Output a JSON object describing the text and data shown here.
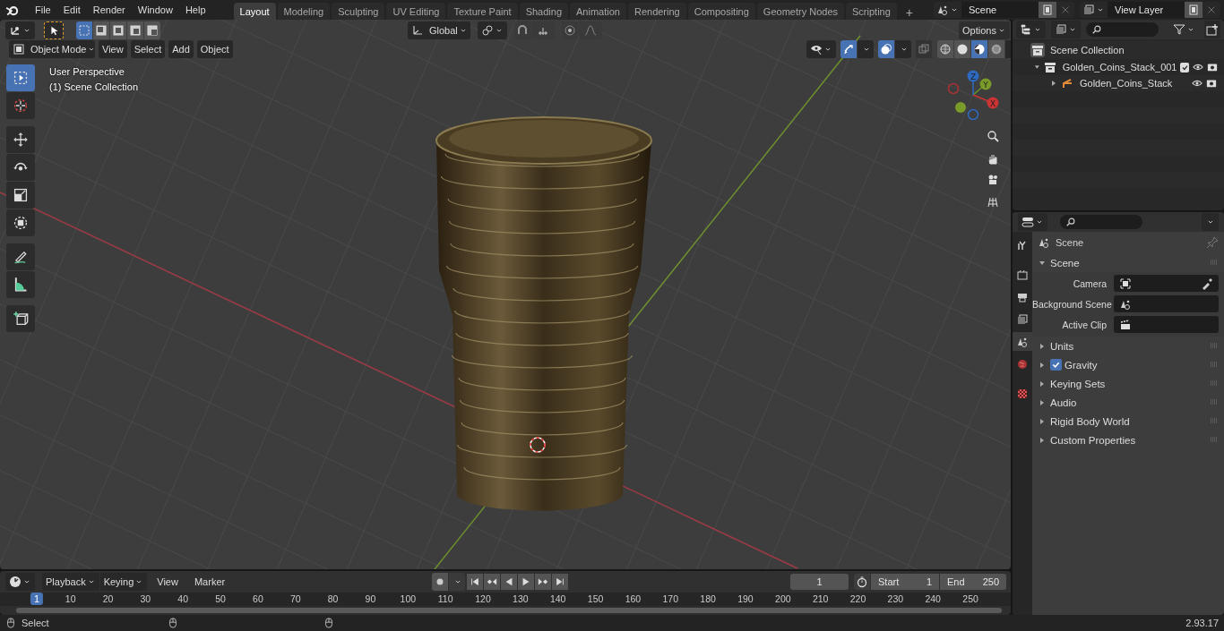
{
  "topbar": {
    "menus": [
      "File",
      "Edit",
      "Render",
      "Window",
      "Help"
    ],
    "workspaces": [
      {
        "label": "Layout",
        "selected": true
      },
      {
        "label": "Modeling",
        "selected": false
      },
      {
        "label": "Sculpting",
        "selected": false
      },
      {
        "label": "UV Editing",
        "selected": false
      },
      {
        "label": "Texture Paint",
        "selected": false
      },
      {
        "label": "Shading",
        "selected": false
      },
      {
        "label": "Animation",
        "selected": false
      },
      {
        "label": "Rendering",
        "selected": false
      },
      {
        "label": "Compositing",
        "selected": false
      },
      {
        "label": "Geometry Nodes",
        "selected": false
      },
      {
        "label": "Scripting",
        "selected": false
      }
    ],
    "add_tab": "+",
    "scene": "Scene",
    "view_layer": "View Layer"
  },
  "viewport": {
    "select_modes": [
      {
        "selected": true
      },
      {
        "selected": false
      },
      {
        "selected": false
      },
      {
        "selected": false
      },
      {
        "selected": false
      }
    ],
    "orientation": "Global",
    "options": "Options",
    "mode": "Object Mode",
    "menus": [
      "View",
      "Select",
      "Add",
      "Object"
    ],
    "toggles": [
      {
        "kind": "gizmo",
        "on": true
      },
      {
        "kind": "overlays",
        "on": true
      },
      {
        "kind": "xray",
        "on": false
      }
    ],
    "shading": [
      {
        "kind": "wireframe",
        "selected": false
      },
      {
        "kind": "solid",
        "selected": false
      },
      {
        "kind": "material",
        "selected": true
      },
      {
        "kind": "rendered",
        "selected": false
      }
    ],
    "info": [
      "User Perspective",
      "(1) Scene Collection"
    ],
    "tools": [
      {
        "kind": "select",
        "selected": true
      },
      {
        "kind": "cursor",
        "selected": false
      },
      {
        "kind": "move",
        "selected": false
      },
      {
        "kind": "rotate",
        "selected": false
      },
      {
        "kind": "scale",
        "selected": false
      },
      {
        "kind": "transform",
        "selected": false
      },
      {
        "kind": "annotate",
        "selected": false
      },
      {
        "kind": "measure",
        "selected": false
      },
      {
        "kind": "add-cube",
        "selected": false
      }
    ],
    "axes": [
      "X",
      "Y",
      "Z"
    ]
  },
  "outliner": {
    "root": "Scene Collection",
    "items": [
      {
        "label": "Golden_Coins_Stack_001",
        "kind": "collection",
        "expanded": true,
        "checked": true,
        "children": [
          {
            "label": "Golden_Coins_Stack",
            "kind": "object",
            "expanded": false
          }
        ]
      }
    ]
  },
  "properties": {
    "tabs": [
      {
        "kind": "tool",
        "selected": false
      },
      {
        "kind": "render",
        "selected": false
      },
      {
        "kind": "output",
        "selected": false
      },
      {
        "kind": "view-layer",
        "selected": false
      },
      {
        "kind": "scene",
        "selected": true
      },
      {
        "kind": "world",
        "selected": false
      },
      {
        "kind": "texture",
        "selected": false
      }
    ],
    "context": "Scene",
    "panel": {
      "title": "Scene",
      "expanded": true,
      "fields": [
        {
          "label": "Camera",
          "kind": "camera"
        },
        {
          "label": "Background Scene",
          "kind": "scene"
        },
        {
          "label": "Active Clip",
          "kind": "clip"
        }
      ]
    },
    "sections": [
      {
        "label": "Units",
        "expanded": false,
        "kind": "plain"
      },
      {
        "label": "Gravity",
        "expanded": false,
        "kind": "checkbox",
        "checked": true
      },
      {
        "label": "Keying Sets",
        "expanded": false,
        "kind": "plain"
      },
      {
        "label": "Audio",
        "expanded": false,
        "kind": "plain"
      },
      {
        "label": "Rigid Body World",
        "expanded": false,
        "kind": "plain"
      },
      {
        "label": "Custom Properties",
        "expanded": false,
        "kind": "plain"
      }
    ]
  },
  "timeline": {
    "menus": [
      "Playback",
      "Keying"
    ],
    "plain_menus": [
      "View",
      "Marker"
    ],
    "current_frame": "1",
    "start_label": "Start",
    "start": "1",
    "end_label": "End",
    "end": "250",
    "marker": "1",
    "ruler": [
      "10",
      "20",
      "30",
      "40",
      "50",
      "60",
      "70",
      "80",
      "90",
      "100",
      "110",
      "120",
      "130",
      "140",
      "150",
      "160",
      "170",
      "180",
      "190",
      "200",
      "210",
      "220",
      "230",
      "240",
      "250"
    ]
  },
  "status": {
    "action": "Select",
    "version": "2.93.17"
  }
}
